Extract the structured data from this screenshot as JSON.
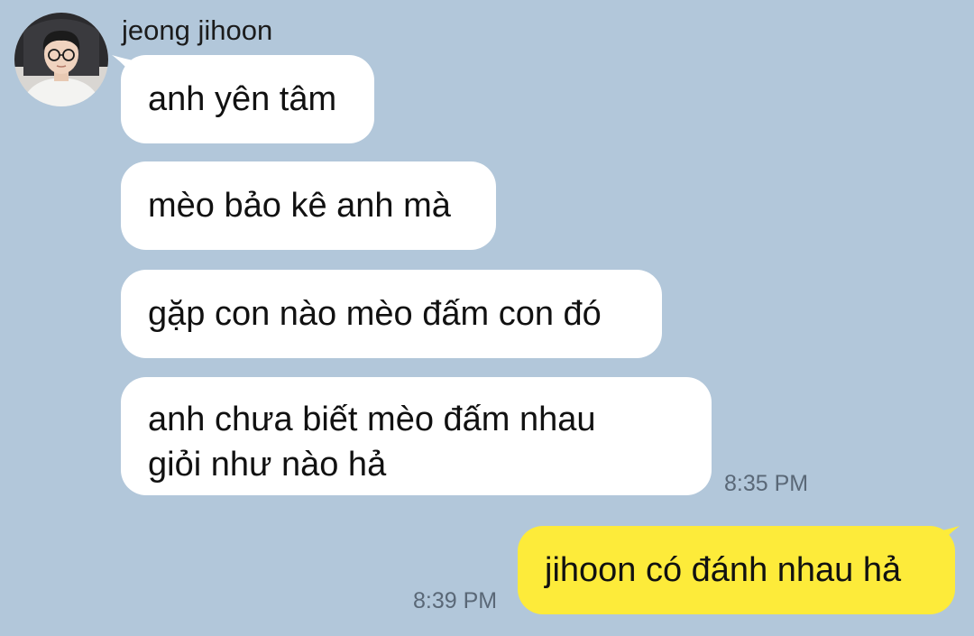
{
  "chat": {
    "sender": {
      "name": "jeong jihoon"
    },
    "incoming_messages": [
      {
        "text": "anh yên tâm"
      },
      {
        "text": "mèo bảo kê anh mà"
      },
      {
        "text": "gặp con nào mèo đấm con đó"
      },
      {
        "text": "anh chưa biết mèo đấm nhau\ngiỏi như nào hả",
        "time": "8:35 PM"
      }
    ],
    "outgoing_messages": [
      {
        "text": "jihoon có đánh nhau hả",
        "time": "8:39 PM"
      }
    ],
    "colors": {
      "background": "#b2c7da",
      "incoming_bubble": "#ffffff",
      "outgoing_bubble": "#fdeb3a",
      "timestamp": "#5a6877"
    }
  }
}
